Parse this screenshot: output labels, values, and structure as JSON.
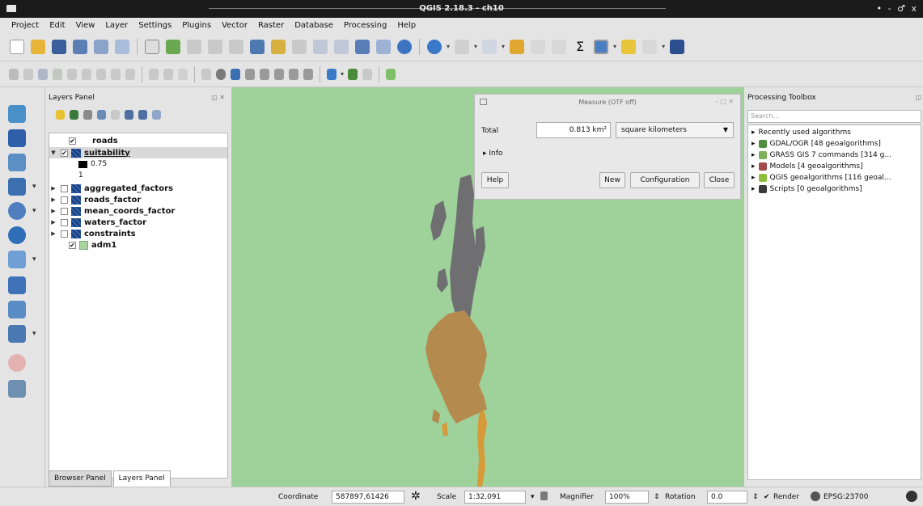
{
  "window": {
    "title": "QGIS 2.18.3 - ch10",
    "controls": "• - ♂ x"
  },
  "menu": [
    "Project",
    "Edit",
    "View",
    "Layer",
    "Settings",
    "Plugins",
    "Vector",
    "Raster",
    "Database",
    "Processing",
    "Help"
  ],
  "layers_panel": {
    "title": "Layers Panel",
    "layers": [
      {
        "name": "roads",
        "checked": true
      },
      {
        "name": "suitability",
        "checked": true,
        "selected": true,
        "legend_value": "0.75",
        "legend_value2": "1"
      },
      {
        "name": "aggregated_factors",
        "checked": false
      },
      {
        "name": "roads_factor",
        "checked": false
      },
      {
        "name": "mean_coords_factor",
        "checked": false
      },
      {
        "name": "waters_factor",
        "checked": false
      },
      {
        "name": "constraints",
        "checked": false
      },
      {
        "name": "adm1",
        "checked": true
      }
    ],
    "tabs": [
      "Browser Panel",
      "Layers Panel"
    ]
  },
  "measure_dialog": {
    "title": "Measure (OTF off)",
    "total_label": "Total",
    "total_value": "0.813 km²",
    "unit": "square kilometers",
    "info_label": "Info",
    "buttons": {
      "help": "Help",
      "new": "New",
      "configuration": "Configuration",
      "close": "Close"
    }
  },
  "processing_toolbox": {
    "title": "Processing Toolbox",
    "search_placeholder": "Search...",
    "items": [
      "Recently used algorithms",
      "GDAL/OGR [48 geoalgorithms]",
      "GRASS GIS 7 commands [314 g...",
      "Models [4 geoalgorithms]",
      "QGIS geoalgorithms [116 geoal...",
      "Scripts [0 geoalgorithms]"
    ]
  },
  "statusbar": {
    "coordinate_label": "Coordinate",
    "coordinate_value": "587897,61426",
    "scale_label": "Scale",
    "scale_value": "1:32,091",
    "magnifier_label": "Magnifier",
    "magnifier_value": "100%",
    "rotation_label": "Rotation",
    "rotation_value": "0.0",
    "render_label": "Render",
    "crs": "EPSG:23700"
  },
  "colors": {
    "map_background": "#9fd19b",
    "suitability_orange": "#b58a4f",
    "constraints_gray": "#6f6f72"
  }
}
